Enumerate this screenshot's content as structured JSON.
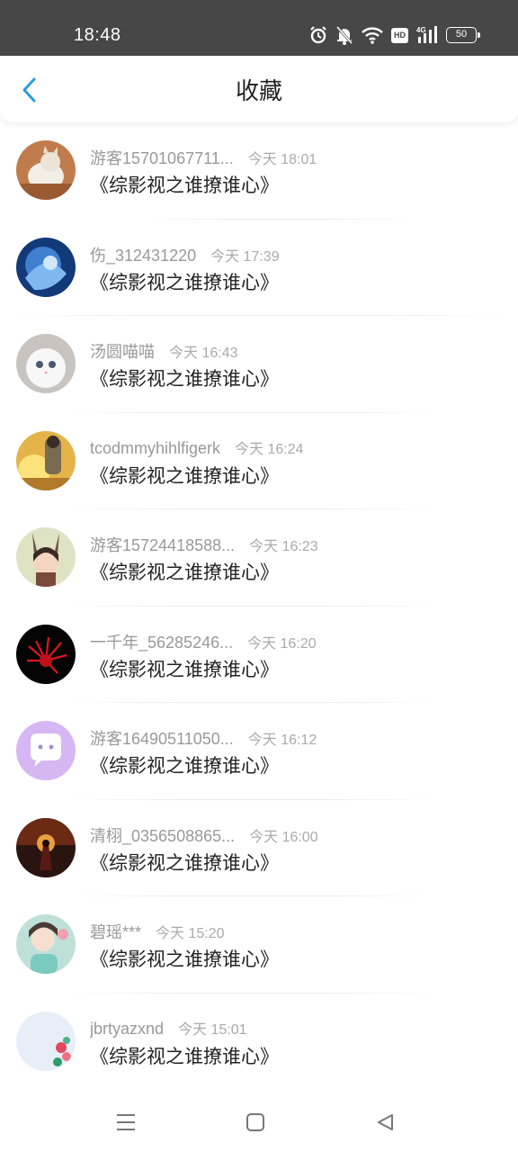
{
  "status_bar": {
    "time": "18:48",
    "hd_label": "HD",
    "network_label": "4G",
    "battery_level": "50",
    "icons": [
      "alarm-icon",
      "mute-bell-icon",
      "wifi-icon",
      "hd-icon",
      "signal-icon",
      "battery-icon"
    ]
  },
  "header": {
    "title": "收藏",
    "back_icon": "chevron-left-icon",
    "accent_color": "#2d9cdb"
  },
  "favorites": [
    {
      "username": "游客15701067711...",
      "time": "今天 18:01",
      "title": "《综影视之谁撩谁心》"
    },
    {
      "username": "伤_312431220",
      "time": "今天 17:39",
      "title": "《综影视之谁撩谁心》"
    },
    {
      "username": "汤圆喵喵",
      "time": "今天 16:43",
      "title": "《综影视之谁撩谁心》"
    },
    {
      "username": "tcodmmyhihlfigerk",
      "time": "今天 16:24",
      "title": "《综影视之谁撩谁心》"
    },
    {
      "username": "游客15724418588...",
      "time": "今天 16:23",
      "title": "《综影视之谁撩谁心》"
    },
    {
      "username": "一千年_56285246...",
      "time": "今天 16:20",
      "title": "《综影视之谁撩谁心》"
    },
    {
      "username": "游客16490511050...",
      "time": "今天 16:12",
      "title": "《综影视之谁撩谁心》"
    },
    {
      "username": "清栩_0356508865...",
      "time": "今天 16:00",
      "title": "《综影视之谁撩谁心》"
    },
    {
      "username": "碧瑶***",
      "time": "今天 15:20",
      "title": "《综影视之谁撩谁心》"
    },
    {
      "username": "jbrtyazxnd",
      "time": "今天 15:01",
      "title": "《综影视之谁撩谁心》"
    }
  ],
  "nav_bar": {
    "icons": [
      "menu-icon",
      "home-square-icon",
      "back-triangle-icon"
    ]
  },
  "colors": {
    "status_bar_bg": "#474747",
    "username_text": "#999999",
    "time_text": "#aaaaaa",
    "title_text": "#222222"
  }
}
